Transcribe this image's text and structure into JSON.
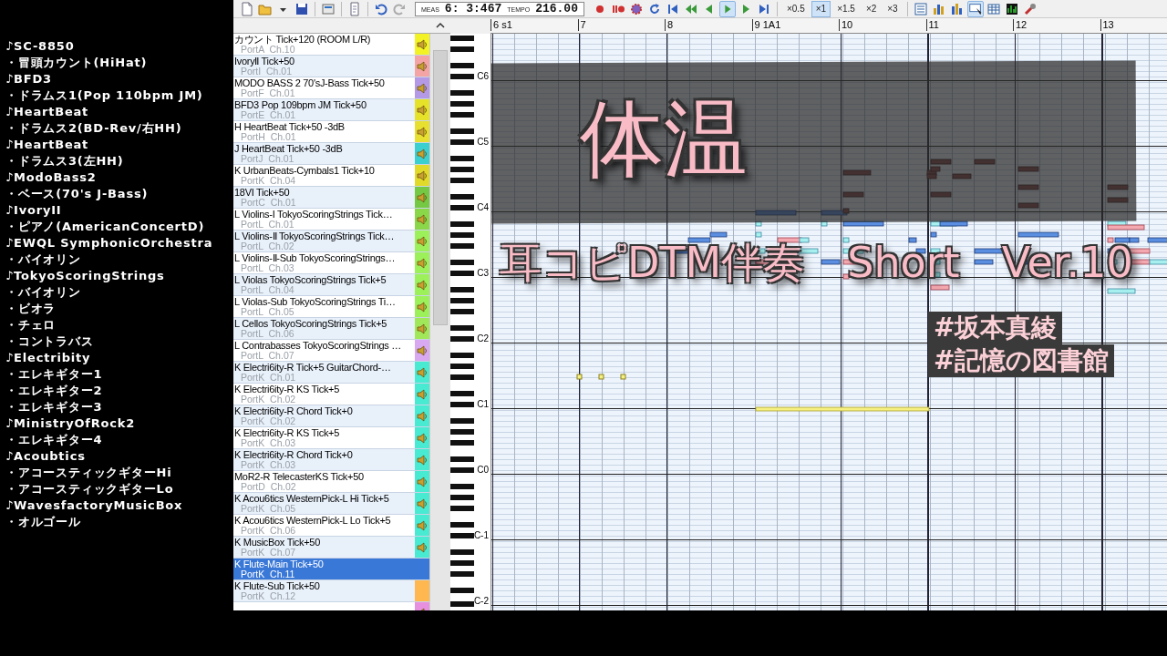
{
  "sidebar": {
    "lines": [
      "♪SC-8850",
      "・冒頭カウント(HiHat)",
      "♪BFD3",
      "・ドラムス1(Pop 110bpm JM)",
      "♪HeartBeat",
      "・ドラムス2(BD-Rev/右HH)",
      "♪HeartBeat",
      "・ドラムス3(左HH)",
      "♪ModoBass2",
      "・ベース(70's J-Bass)",
      "♪IvoryII",
      "・ピアノ(AmericanConcertD)",
      "♪EWQL SymphonicOrchestra",
      "・バイオリン",
      "♪TokyoScoringStrings",
      "・バイオリン",
      "・ビオラ",
      "・チェロ",
      "・コントラバス",
      "♪Electribity",
      "・エレキギター1",
      "・エレキギター2",
      "・エレキギター3",
      "♪MinistryOfRock2",
      "・エレキギター4",
      "♪Acoubtics",
      "・アコースティックギターHi",
      "・アコースティックギターLo",
      "♪WavesfactoryMusicBox",
      "・オルゴール"
    ]
  },
  "toolbar": {
    "meas_label": "MEAS",
    "meas_value": "6: 3:467",
    "tempo_label": "TEMPO",
    "tempo_value": "216.00",
    "speeds": [
      {
        "label": "×0.5",
        "selected": false
      },
      {
        "label": "×1",
        "selected": true
      },
      {
        "label": "×1.5",
        "selected": false
      },
      {
        "label": "×2",
        "selected": false
      },
      {
        "label": "×3",
        "selected": false
      }
    ]
  },
  "ruler": {
    "measures": [
      "6 s1",
      "7",
      "8",
      "9 1A1",
      "10",
      "11",
      "12",
      "13"
    ]
  },
  "tracks": [
    {
      "name": "カウント Tick+120 (ROOM L/R)",
      "port": "PortA  Ch.10",
      "color": "#f2f224",
      "speaker_on": true,
      "selected": false
    },
    {
      "name": "IvoryⅡ Tick+50",
      "port": "PortI  Ch.01",
      "color": "#f4a4a4",
      "speaker_on": true,
      "selected": false
    },
    {
      "name": "MODO BASS 2 70'sJ-Bass Tick+50",
      "port": "PortF  Ch.01",
      "color": "#b49ae6",
      "speaker_on": true,
      "selected": false
    },
    {
      "name": "BFD3 Pop 109bpm JM Tick+50",
      "port": "PortE  Ch.01",
      "color": "#e6e22a",
      "speaker_on": true,
      "selected": false
    },
    {
      "name": "H HeartBeat Tick+50 -3dB",
      "port": "PortH  Ch.01",
      "color": "#e8e030",
      "speaker_on": true,
      "selected": false
    },
    {
      "name": "J HeartBeat Tick+50 -3dB",
      "port": "PortJ  Ch.01",
      "color": "#3ccfcf",
      "speaker_on": true,
      "selected": false
    },
    {
      "name": "K UrbanBeats-Cymbals1 Tick+10",
      "port": "PortK  Ch.04",
      "color": "#e2da2a",
      "speaker_on": true,
      "selected": false
    },
    {
      "name": "18VI Tick+50",
      "port": "PortC  Ch.01",
      "color": "#74c844",
      "speaker_on": true,
      "selected": false
    },
    {
      "name": "L Violins-I TokyoScoringStrings Tick…",
      "port": "PortL  Ch.01",
      "color": "#8ad84a",
      "speaker_on": true,
      "selected": false
    },
    {
      "name": "L Violins-Ⅱ TokyoScoringStrings Tick…",
      "port": "PortL  Ch.02",
      "color": "#9cf05a",
      "speaker_on": true,
      "selected": false
    },
    {
      "name": "L Violins-Ⅱ-Sub TokyoScoringStrings…",
      "port": "PortL  Ch.03",
      "color": "#9cf05a",
      "speaker_on": true,
      "selected": false
    },
    {
      "name": "L Violas TokyoScoringStrings Tick+5",
      "port": "PortL  Ch.04",
      "color": "#9cf05a",
      "speaker_on": true,
      "selected": false
    },
    {
      "name": "L Violas-Sub TokyoScoringStrings Ti…",
      "port": "PortL  Ch.05",
      "color": "#9cf05a",
      "speaker_on": true,
      "selected": false
    },
    {
      "name": "L Cellos TokyoScoringStrings Tick+5",
      "port": "PortL  Ch.06",
      "color": "#a0e85a",
      "speaker_on": true,
      "selected": false
    },
    {
      "name": "L Contrabasses TokyoScoringStrings …",
      "port": "PortL  Ch.07",
      "color": "#d8a8f0",
      "speaker_on": true,
      "selected": false
    },
    {
      "name": "K Electri6ity-R Tick+5 GuitarChord-…",
      "port": "PortK  Ch.01",
      "color": "#48ead2",
      "speaker_on": true,
      "selected": false
    },
    {
      "name": "K Electri6ity-R KS Tick+5",
      "port": "PortK  Ch.02",
      "color": "#48ead2",
      "speaker_on": true,
      "selected": false
    },
    {
      "name": "K Electri6ity-R Chord Tick+0",
      "port": "PortK  Ch.02",
      "color": "#48ead2",
      "speaker_on": true,
      "selected": false
    },
    {
      "name": "K Electri6ity-R KS Tick+5",
      "port": "PortK  Ch.03",
      "color": "#48ead2",
      "speaker_on": true,
      "selected": false
    },
    {
      "name": "K Electri6ity-R Chord Tick+0",
      "port": "PortK  Ch.03",
      "color": "#48ead2",
      "speaker_on": true,
      "selected": false
    },
    {
      "name": "MoR2-R TelecasterKS Tick+50",
      "port": "PortD  Ch.02",
      "color": "#48ead2",
      "speaker_on": true,
      "selected": false
    },
    {
      "name": "K Acou6tics WesternPick-L Hi Tick+5",
      "port": "PortK  Ch.05",
      "color": "#48ead2",
      "speaker_on": true,
      "selected": false
    },
    {
      "name": "K Acou6tics WesternPick-L Lo Tick+5",
      "port": "PortK  Ch.06",
      "color": "#48ead2",
      "speaker_on": true,
      "selected": false
    },
    {
      "name": "K MusicBox Tick+50",
      "port": "PortK  Ch.07",
      "color": "#48ead2",
      "speaker_on": true,
      "selected": false
    },
    {
      "name": "K Flute-Main Tick+50",
      "port": "PortK  Ch.11",
      "color": "#3a78d8",
      "speaker_on": false,
      "selected": true
    },
    {
      "name": "K Flute-Sub Tick+50",
      "port": "PortK  Ch.12",
      "color": "#ffb850",
      "speaker_on": false,
      "selected": false
    },
    {
      "color": "#e890e0",
      "speaker_on": true,
      "selected": false
    }
  ],
  "keyboard": {
    "octaves": [
      "C6",
      "C5",
      "C4",
      "C3",
      "C2",
      "C1",
      "C0",
      "C-1",
      "C-2"
    ]
  },
  "overlay": {
    "title": "体温",
    "subtitle": "耳コピDTM伴奏　Short　Ver.10",
    "tags": [
      "#坂本真綾",
      "#記憶の図書館"
    ]
  }
}
